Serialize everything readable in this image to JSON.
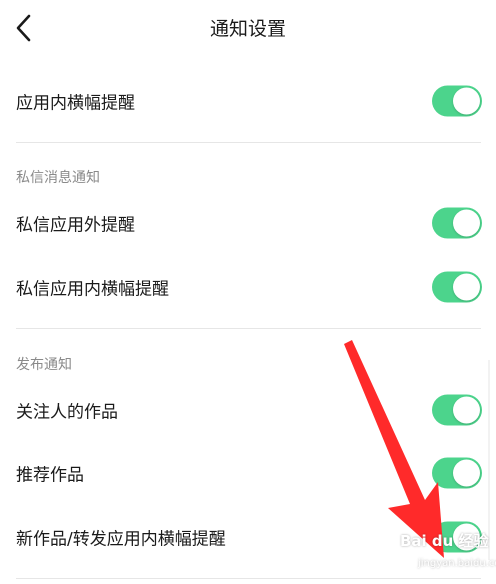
{
  "header": {
    "title": "通知设置",
    "back_icon": "chevron-left-icon"
  },
  "settings": {
    "in_app_banner": {
      "label": "应用内横幅提醒",
      "enabled": true
    },
    "private_message": {
      "section_title": "私信消息通知",
      "items": [
        {
          "label": "私信应用外提醒",
          "enabled": true
        },
        {
          "label": "私信应用内横幅提醒",
          "enabled": true
        }
      ]
    },
    "publish": {
      "section_title": "发布通知",
      "items": [
        {
          "label": "关注人的作品",
          "enabled": true
        },
        {
          "label": "推荐作品",
          "enabled": true
        },
        {
          "label": "新作品/转发应用内横幅提醒",
          "enabled": true
        }
      ]
    }
  },
  "colors": {
    "toggle_on": "#4cd48c",
    "annotation_arrow": "#ff2a2a"
  },
  "watermark": {
    "text": "Bai du 经验",
    "subtext": "jingyan.baidu.com"
  }
}
